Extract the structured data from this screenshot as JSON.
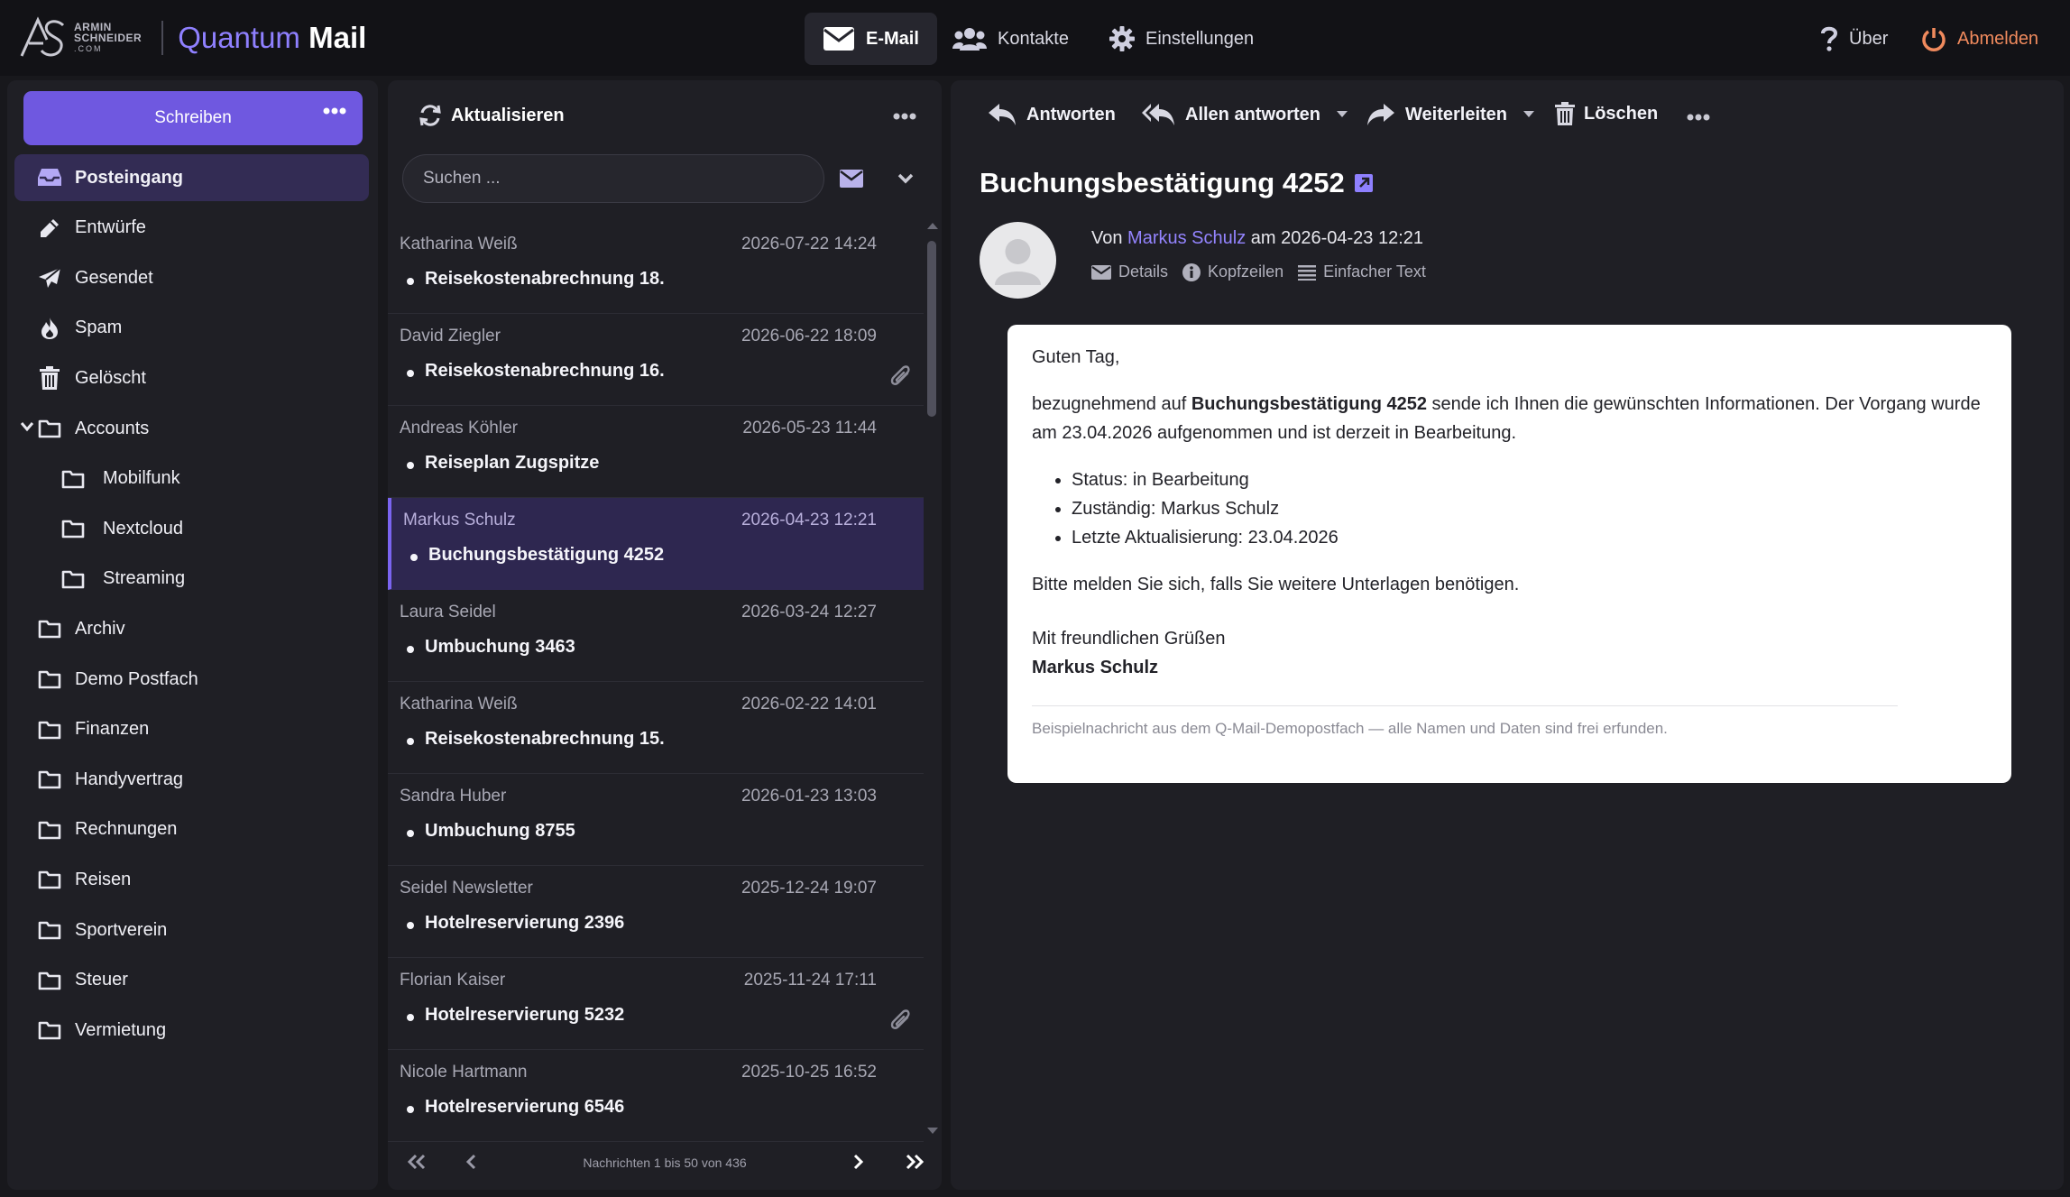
{
  "app": {
    "company_line1": "ARMIN",
    "company_line2": "SCHNEIDER",
    "company_line3": ".COM",
    "name_part1": "Quantum",
    "name_part2": "Mail"
  },
  "nav": {
    "email": "E-Mail",
    "contacts": "Kontakte",
    "settings": "Einstellungen",
    "about": "Über",
    "logout": "Abmelden"
  },
  "sidebar": {
    "compose_label": "Schreiben",
    "folders": [
      {
        "label": "Posteingang",
        "icon": "inbox-icon",
        "active": true
      },
      {
        "label": "Entwürfe",
        "icon": "pencil-icon"
      },
      {
        "label": "Gesendet",
        "icon": "paper-plane-icon"
      },
      {
        "label": "Spam",
        "icon": "fire-icon"
      },
      {
        "label": "Gelöscht",
        "icon": "trash-icon"
      },
      {
        "label": "Accounts",
        "icon": "folder-icon",
        "expanded": true
      },
      {
        "label": "Mobilfunk",
        "icon": "folder-icon",
        "sub": true
      },
      {
        "label": "Nextcloud",
        "icon": "folder-icon",
        "sub": true
      },
      {
        "label": "Streaming",
        "icon": "folder-icon",
        "sub": true
      },
      {
        "label": "Archiv",
        "icon": "folder-icon"
      },
      {
        "label": "Demo Postfach",
        "icon": "folder-icon"
      },
      {
        "label": "Finanzen",
        "icon": "folder-icon"
      },
      {
        "label": "Handyvertrag",
        "icon": "folder-icon"
      },
      {
        "label": "Rechnungen",
        "icon": "folder-icon"
      },
      {
        "label": "Reisen",
        "icon": "folder-icon"
      },
      {
        "label": "Sportverein",
        "icon": "folder-icon"
      },
      {
        "label": "Steuer",
        "icon": "folder-icon"
      },
      {
        "label": "Vermietung",
        "icon": "folder-icon"
      }
    ]
  },
  "list": {
    "refresh_label": "Aktualisieren",
    "search_placeholder": "Suchen ...",
    "pager_info": "Nachrichten 1 bis 50 von 436",
    "messages": [
      {
        "from": "Katharina Weiß",
        "date": "2026-07-22 14:24",
        "subject": "Reisekostenabrechnung 18.",
        "attachment": false
      },
      {
        "from": "David Ziegler",
        "date": "2026-06-22 18:09",
        "subject": "Reisekostenabrechnung 16.",
        "attachment": true
      },
      {
        "from": "Andreas Köhler",
        "date": "2026-05-23 11:44",
        "subject": "Reiseplan Zugspitze",
        "attachment": false
      },
      {
        "from": "Markus Schulz",
        "date": "2026-04-23 12:21",
        "subject": "Buchungsbestätigung 4252",
        "attachment": false,
        "selected": true
      },
      {
        "from": "Laura Seidel",
        "date": "2026-03-24 12:27",
        "subject": "Umbuchung 3463",
        "attachment": false
      },
      {
        "from": "Katharina Weiß",
        "date": "2026-02-22 14:01",
        "subject": "Reisekostenabrechnung 15.",
        "attachment": false
      },
      {
        "from": "Sandra Huber",
        "date": "2026-01-23 13:03",
        "subject": "Umbuchung 8755",
        "attachment": false
      },
      {
        "from": "Seidel Newsletter",
        "date": "2025-12-24 19:07",
        "subject": "Hotelreservierung 2396",
        "attachment": false
      },
      {
        "from": "Florian Kaiser",
        "date": "2025-11-24 17:11",
        "subject": "Hotelreservierung 5232",
        "attachment": true
      },
      {
        "from": "Nicole Hartmann",
        "date": "2025-10-25 16:52",
        "subject": "Hotelreservierung 6546",
        "attachment": false
      }
    ]
  },
  "toolbar": {
    "reply": "Antworten",
    "reply_all": "Allen antworten",
    "forward": "Weiterleiten",
    "delete": "Löschen"
  },
  "mail": {
    "title": "Buchungsbestätigung 4252",
    "from_prefix": "Von",
    "from_name": "Markus Schulz",
    "date_prefix": "am",
    "date": "2026-04-23 12:21",
    "details_label": "Details",
    "headers_label": "Kopfzeilen",
    "plaintext_label": "Einfacher Text",
    "greeting": "Guten Tag,",
    "intro_before": "bezugnehmend auf",
    "intro_bold": "Buchungsbestätigung 4252",
    "intro_after": "sende ich Ihnen die gewünschten Informationen. Der Vorgang wurde am 23.04.2026 aufgenommen und ist derzeit in Bearbeitung.",
    "list_items": [
      "Status: in Bearbeitung",
      "Zuständig: Markus Schulz",
      "Letzte Aktualisierung: 23.04.2026"
    ],
    "closing_request": "Bitte melden Sie sich, falls Sie weitere Unterlagen benötigen.",
    "regards": "Mit freundlichen Grüßen",
    "signature": "Markus Schulz",
    "footer_note": "Beispielnachricht aus dem Q-Mail-Demopostfach — alle Namen und Daten sind frei erfunden."
  },
  "colors": {
    "accent": "#6f58e0",
    "accent_link": "#9484ff",
    "logout": "#f08a5d",
    "background": "#18181c",
    "panel": "#1f1f25"
  }
}
